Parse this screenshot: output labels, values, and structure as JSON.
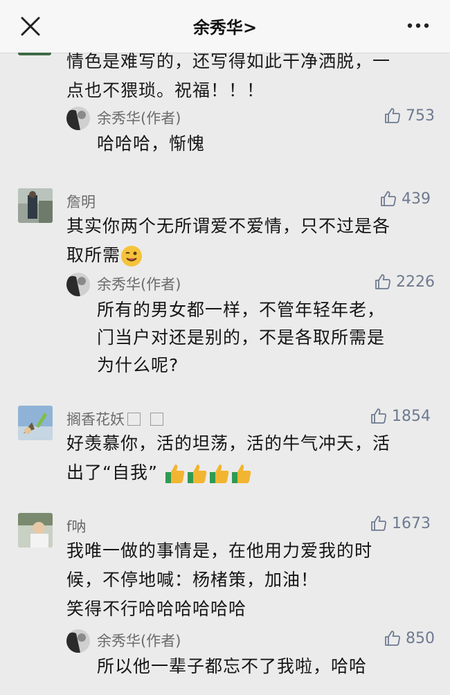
{
  "header": {
    "title": "余秀华",
    "chevron": ">",
    "close_icon": "close-icon",
    "more_icon": "more-icon"
  },
  "partial_comment": {
    "line1": "情色是难写的，还写得如此干净洒脱，一",
    "line2": "点也不猥琐。祝福！！！"
  },
  "replies": [
    {
      "name": "余秀华(作者)",
      "likes": "753",
      "lines": [
        "哈哈哈，惭愧"
      ]
    }
  ],
  "comments": [
    {
      "name": "詹明",
      "likes": "439",
      "lines": [
        "其实你两个无所谓爱不爱情，只不过是各",
        "取所需"
      ],
      "reply": {
        "name": "余秀华(作者)",
        "likes": "2226",
        "lines": [
          "所有的男女都一样，不管年轻年老，",
          "门当户对还是别的，不是各取所需是",
          "为什么呢?"
        ]
      }
    },
    {
      "name": "搁香花妖",
      "likes": "1854",
      "lines": [
        "好羡慕你，活的坦荡，活的牛气冲天，活",
        "出了“自我”"
      ]
    },
    {
      "name": "f呐",
      "likes": "1673",
      "lines": [
        "我唯一做的事情是，在他用力爱我的时",
        "候，不停地喊：杨楮策，加油！",
        "笑得不行哈哈哈哈哈哈"
      ],
      "reply": {
        "name": "余秀华(作者)",
        "likes": "850",
        "lines": [
          "所以他一辈子都忘不了我啦，哈哈"
        ]
      }
    }
  ],
  "colors": {
    "background": "#ebebeb",
    "like_color": "#6e7a90",
    "name_color": "#6b6b6b"
  }
}
